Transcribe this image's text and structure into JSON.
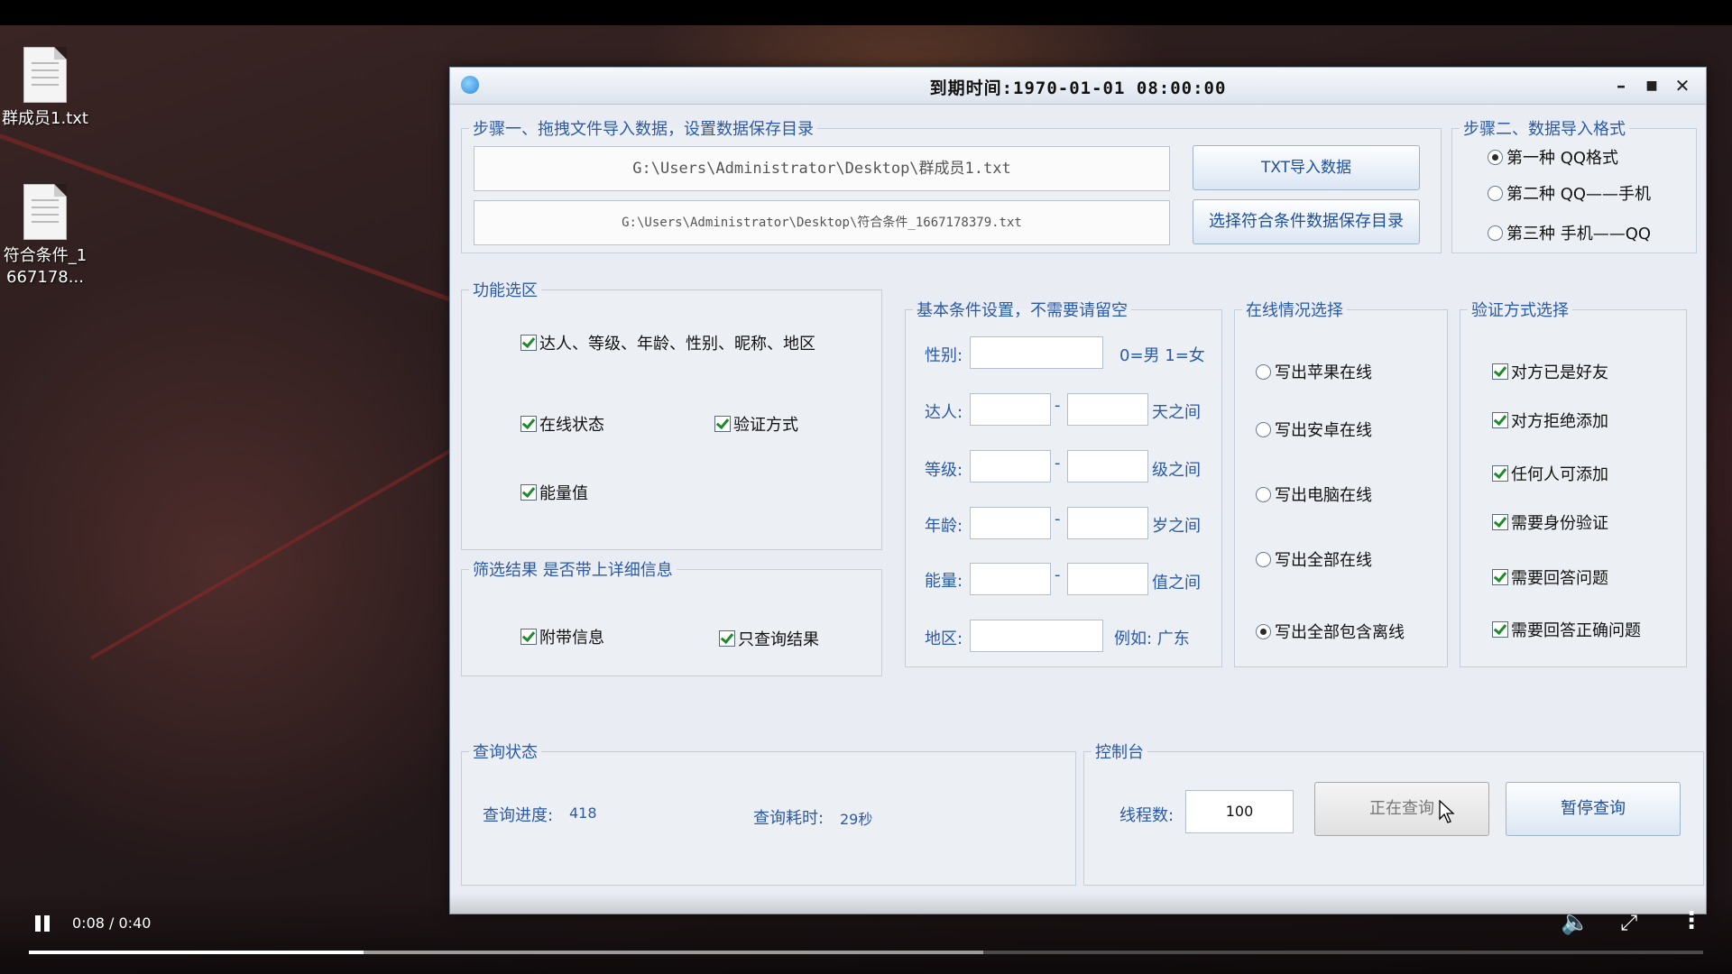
{
  "desktop": {
    "icons": [
      {
        "label": "群成员1.txt"
      },
      {
        "label": "符合条件_1667178..."
      }
    ]
  },
  "window": {
    "title": "到期时间:1970-01-01 08:00:00",
    "controls": {
      "minimize": "–",
      "maximize": "■",
      "close": "✕"
    }
  },
  "step1": {
    "legend": "步骤一、拖拽文件导入数据，设置数据保存目录",
    "import_path": "G:\\Users\\Administrator\\Desktop\\群成员1.txt",
    "save_path": "G:\\Users\\Administrator\\Desktop\\符合条件_1667178379.txt",
    "import_button": "TXT导入数据",
    "save_button": "选择符合条件数据保存目录"
  },
  "step2": {
    "legend": "步骤二、数据导入格式",
    "options": [
      {
        "label": "第一种 QQ格式",
        "selected": true
      },
      {
        "label": "第二种 QQ——手机",
        "selected": false
      },
      {
        "label": "第三种 手机——QQ",
        "selected": false
      }
    ]
  },
  "features": {
    "legend": "功能选区",
    "items": [
      {
        "label": "达人、等级、年龄、性别、昵称、地区",
        "checked": true
      },
      {
        "label": "在线状态",
        "checked": true
      },
      {
        "label": "验证方式",
        "checked": true
      },
      {
        "label": "能量值",
        "checked": true
      }
    ]
  },
  "filter": {
    "legend": "筛选结果 是否带上详细信息",
    "items": [
      {
        "label": "附带信息",
        "checked": true
      },
      {
        "label": "只查询结果",
        "checked": true
      }
    ]
  },
  "basic": {
    "legend": "基本条件设置，不需要请留空",
    "gender_label": "性别:",
    "gender_hint": "0=男  1=女",
    "daren_label": "达人:",
    "daren_unit": "天之间",
    "level_label": "等级:",
    "level_unit": "级之间",
    "age_label": "年龄:",
    "age_unit": "岁之间",
    "energy_label": "能量:",
    "energy_unit": "值之间",
    "region_label": "地区:",
    "region_hint": "例如:  广东",
    "dash": "-"
  },
  "online": {
    "legend": "在线情况选择",
    "options": [
      {
        "label": "写出苹果在线",
        "selected": false
      },
      {
        "label": "写出安卓在线",
        "selected": false
      },
      {
        "label": "写出电脑在线",
        "selected": false
      },
      {
        "label": "写出全部在线",
        "selected": false
      },
      {
        "label": "写出全部包含离线",
        "selected": true
      }
    ]
  },
  "verify": {
    "legend": "验证方式选择",
    "items": [
      {
        "label": "对方已是好友",
        "checked": true
      },
      {
        "label": "对方拒绝添加",
        "checked": true
      },
      {
        "label": "任何人可添加",
        "checked": true
      },
      {
        "label": "需要身份验证",
        "checked": true
      },
      {
        "label": "需要回答问题",
        "checked": true
      },
      {
        "label": "需要回答正确问题",
        "checked": true
      }
    ]
  },
  "status": {
    "legend": "查询状态",
    "progress_label": "查询进度:",
    "progress_value": "418",
    "elapsed_label": "查询耗时:",
    "elapsed_value": "29秒"
  },
  "console": {
    "legend": "控制台",
    "threads_label": "线程数:",
    "threads_value": "100",
    "query_button": "正在查询",
    "pause_button": "暂停查询"
  },
  "player": {
    "time": "0:08 / 0:40",
    "played_fraction": 0.2,
    "buffered_fraction": 0.57
  }
}
